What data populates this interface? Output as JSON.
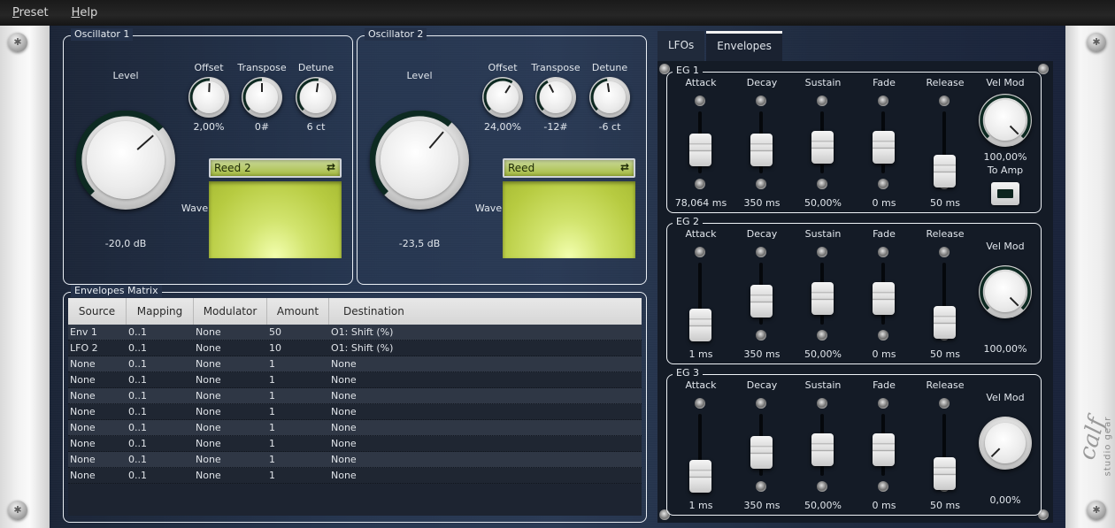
{
  "menu": [
    {
      "label": "Preset",
      "mnemonic": "P",
      "rest": "reset"
    },
    {
      "label": "Help",
      "mnemonic": "H",
      "rest": "elp"
    }
  ],
  "brand": {
    "logo": "calf",
    "tagline": "studio gear"
  },
  "oscillators": [
    {
      "title": "Oscillator 1",
      "level": {
        "label": "Level",
        "value": "-20,0 dB",
        "fraction": 0.68
      },
      "offset": {
        "label": "Offset",
        "value": "2,00%",
        "fraction": 0.51
      },
      "transpose": {
        "label": "Transpose",
        "value": "0#",
        "fraction": 0.5
      },
      "detune": {
        "label": "Detune",
        "value": "6 ct",
        "fraction": 0.53
      },
      "wave": {
        "label": "Wave",
        "selected": "Reed 2",
        "switch_icon": "swap-arrows-icon"
      }
    },
    {
      "title": "Oscillator 2",
      "level": {
        "label": "Level",
        "value": "-23,5 dB",
        "fraction": 0.65
      },
      "offset": {
        "label": "Offset",
        "value": "24,00%",
        "fraction": 0.62
      },
      "transpose": {
        "label": "Transpose",
        "value": "-12#",
        "fraction": 0.4
      },
      "detune": {
        "label": "Detune",
        "value": "-6 ct",
        "fraction": 0.47
      },
      "wave": {
        "label": "Wave",
        "selected": "Reed",
        "switch_icon": "swap-arrows-icon"
      }
    }
  ],
  "matrix": {
    "title": "Envelopes Matrix",
    "columns": [
      "Source",
      "Mapping",
      "Modulator",
      "Amount",
      "Destination"
    ],
    "rows": [
      [
        "Env 1",
        "0..1",
        "None",
        "50",
        "O1: Shift (%)"
      ],
      [
        "LFO 2",
        "0..1",
        "None",
        "10",
        "O1: Shift (%)"
      ],
      [
        "None",
        "0..1",
        "None",
        "1",
        "None"
      ],
      [
        "None",
        "0..1",
        "None",
        "1",
        "None"
      ],
      [
        "None",
        "0..1",
        "None",
        "1",
        "None"
      ],
      [
        "None",
        "0..1",
        "None",
        "1",
        "None"
      ],
      [
        "None",
        "0..1",
        "None",
        "1",
        "None"
      ],
      [
        "None",
        "0..1",
        "None",
        "1",
        "None"
      ],
      [
        "None",
        "0..1",
        "None",
        "1",
        "None"
      ],
      [
        "None",
        "0..1",
        "None",
        "1",
        "None"
      ]
    ]
  },
  "tabs": [
    {
      "label": "LFOs",
      "active": false
    },
    {
      "label": "Envelopes",
      "active": true
    }
  ],
  "envelopes": [
    {
      "title": "EG 1",
      "sliders": [
        {
          "label": "Attack",
          "value": "78,064 ms",
          "fraction": 0.5
        },
        {
          "label": "Decay",
          "value": "350 ms",
          "fraction": 0.5
        },
        {
          "label": "Sustain",
          "value": "50,00%",
          "fraction": 0.55
        },
        {
          "label": "Fade",
          "value": "0 ms",
          "fraction": 0.55
        },
        {
          "label": "Release",
          "value": "50 ms",
          "fraction": 0.05
        }
      ],
      "velmod": {
        "label": "Vel Mod",
        "value": "100,00%",
        "fraction": 1.0
      },
      "to_amp": {
        "label": "To Amp",
        "on": false
      }
    },
    {
      "title": "EG 2",
      "sliders": [
        {
          "label": "Attack",
          "value": "1 ms",
          "fraction": 0.0
        },
        {
          "label": "Decay",
          "value": "350 ms",
          "fraction": 0.5
        },
        {
          "label": "Sustain",
          "value": "50,00%",
          "fraction": 0.55
        },
        {
          "label": "Fade",
          "value": "0 ms",
          "fraction": 0.55
        },
        {
          "label": "Release",
          "value": "50 ms",
          "fraction": 0.05
        }
      ],
      "velmod": {
        "label": "Vel Mod",
        "value": "100,00%",
        "fraction": 1.0
      }
    },
    {
      "title": "EG 3",
      "sliders": [
        {
          "label": "Attack",
          "value": "1 ms",
          "fraction": 0.0
        },
        {
          "label": "Decay",
          "value": "350 ms",
          "fraction": 0.5
        },
        {
          "label": "Sustain",
          "value": "50,00%",
          "fraction": 0.55
        },
        {
          "label": "Fade",
          "value": "0 ms",
          "fraction": 0.55
        },
        {
          "label": "Release",
          "value": "50 ms",
          "fraction": 0.05
        }
      ],
      "velmod": {
        "label": "Vel Mod",
        "value": "0,00%",
        "fraction": 0.0
      }
    }
  ]
}
